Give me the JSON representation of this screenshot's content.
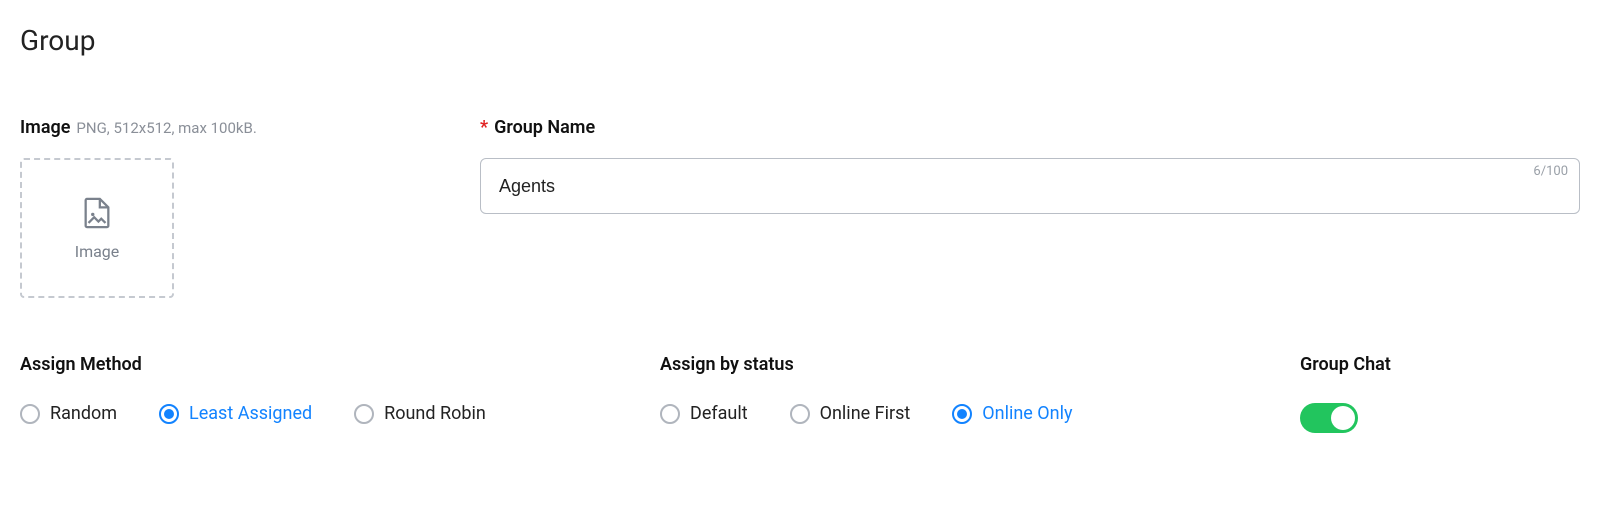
{
  "page_title": "Group",
  "image": {
    "label": "Image",
    "hint": "PNG, 512x512, max 100kB.",
    "placeholder": "Image"
  },
  "group_name": {
    "label": "Group Name",
    "required": true,
    "value": "Agents",
    "char_count": "6/100"
  },
  "assign_method": {
    "label": "Assign Method",
    "options": [
      {
        "value": "random",
        "label": "Random",
        "selected": false
      },
      {
        "value": "least_assigned",
        "label": "Least Assigned",
        "selected": true
      },
      {
        "value": "round_robin",
        "label": "Round Robin",
        "selected": false
      }
    ]
  },
  "assign_status": {
    "label": "Assign by status",
    "options": [
      {
        "value": "default",
        "label": "Default",
        "selected": false
      },
      {
        "value": "online_first",
        "label": "Online First",
        "selected": false
      },
      {
        "value": "online_only",
        "label": "Online Only",
        "selected": true
      }
    ]
  },
  "group_chat": {
    "label": "Group Chat",
    "enabled": true
  }
}
